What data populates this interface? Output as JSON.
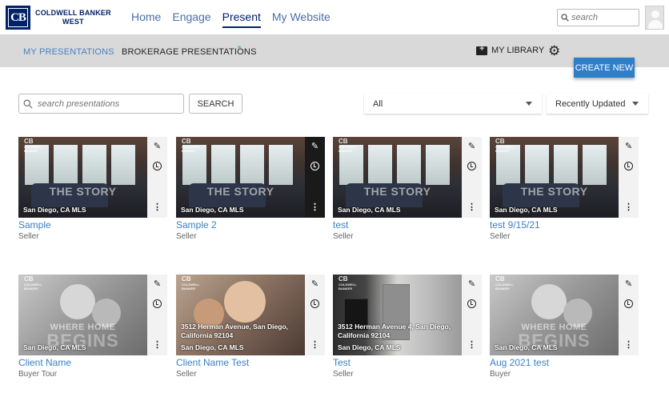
{
  "brand": {
    "logo_mark": "CB",
    "line1": "COLDWELL BANKER",
    "line2": "WEST",
    "color": "#012169"
  },
  "nav": {
    "items": [
      {
        "label": "Home",
        "active": false
      },
      {
        "label": "Engage",
        "active": false
      },
      {
        "label": "Present",
        "active": true
      },
      {
        "label": "My Website",
        "active": false
      }
    ],
    "search_placeholder": "search"
  },
  "subnav": {
    "tabs": [
      {
        "label": "MY PRESENTATIONS",
        "active": true
      },
      {
        "label": "BROKERAGE PRESENTATIONS",
        "active": false
      }
    ],
    "library_label": "MY LIBRARY",
    "create_label": "CREATE NEW"
  },
  "filters": {
    "search_placeholder": "search presentations",
    "search_button": "SEARCH",
    "type_value": "All",
    "sort_value": "Recently Updated"
  },
  "cards": [
    {
      "title": "Sample",
      "subtitle": "Seller",
      "mls": "San Diego, CA MLS",
      "overlay": "THE STORY",
      "overlay2": "",
      "address": "",
      "theme": "living"
    },
    {
      "title": "Sample 2",
      "subtitle": "Seller",
      "mls": "San Diego, CA MLS",
      "overlay": "THE STORY",
      "overlay2": "",
      "address": "",
      "theme": "living"
    },
    {
      "title": "test",
      "subtitle": "Seller",
      "mls": "San Diego, CA MLS",
      "overlay": "THE STORY",
      "overlay2": "",
      "address": "",
      "theme": "living"
    },
    {
      "title": "test 9/15/21",
      "subtitle": "Seller",
      "mls": "San Diego, CA MLS",
      "overlay": "THE STORY",
      "overlay2": "",
      "address": "",
      "theme": "living"
    },
    {
      "title": "Client Name",
      "subtitle": "Buyer Tour",
      "mls": "San Diego, CA MLS",
      "overlay": "WHERE HOME",
      "overlay2": "BEGINS",
      "address": "",
      "theme": "family"
    },
    {
      "title": "Client Name Test",
      "subtitle": "Seller",
      "mls": "San Diego, CA MLS",
      "overlay": "",
      "overlay2": "",
      "address": "3512 Herman Avenue, San Diego, California 92104",
      "theme": "color"
    },
    {
      "title": "Test",
      "subtitle": "Seller",
      "mls": "San Diego, CA MLS",
      "overlay": "",
      "overlay2": "",
      "address": "3512 Herman Avenue 4, San Diego, California 92104",
      "theme": "kitchen"
    },
    {
      "title": "Aug 2021 test",
      "subtitle": "Buyer",
      "mls": "San Diego, CA MLS",
      "overlay": "WHERE HOME",
      "overlay2": "BEGINS",
      "address": "",
      "theme": "family"
    }
  ],
  "icons": {
    "edit": "pencil-icon",
    "history": "clock-icon",
    "more": "more-vertical-icon",
    "settings": "gear-icon",
    "library": "folder-plus-icon",
    "search": "search-icon"
  },
  "colors": {
    "accent": "#2d7fc9",
    "link": "#3b7fc4",
    "navy": "#012169",
    "subbar": "#d9d9d9"
  }
}
